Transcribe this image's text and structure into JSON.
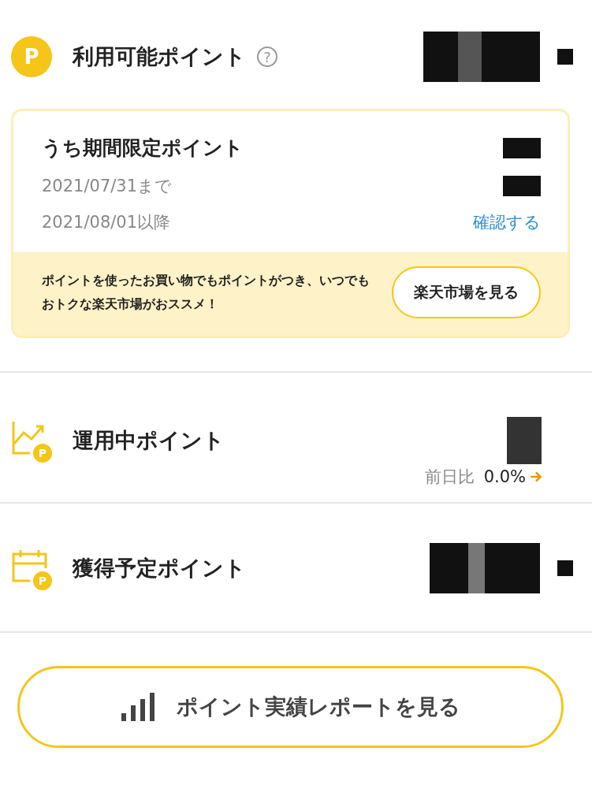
{
  "available": {
    "badge": "P",
    "title": "利用可能ポイント",
    "help": "?"
  },
  "limited_card": {
    "title": "うち期間限定ポイント",
    "rows": [
      {
        "label": "2021/07/31まで"
      },
      {
        "label": "2021/08/01以降",
        "link": "確認する"
      }
    ],
    "promo": {
      "text": "ポイントを使ったお買い物でもポイントがつき、いつでもおトクな楽天市場がおススメ！",
      "button": "楽天市場を見る"
    }
  },
  "invested": {
    "badge": "P",
    "title": "運用中ポイント",
    "change_label": "前日比",
    "change_value": "0.0%"
  },
  "upcoming": {
    "badge": "P",
    "title": "獲得予定ポイント"
  },
  "report_button": "ポイント実績レポートを見る"
}
